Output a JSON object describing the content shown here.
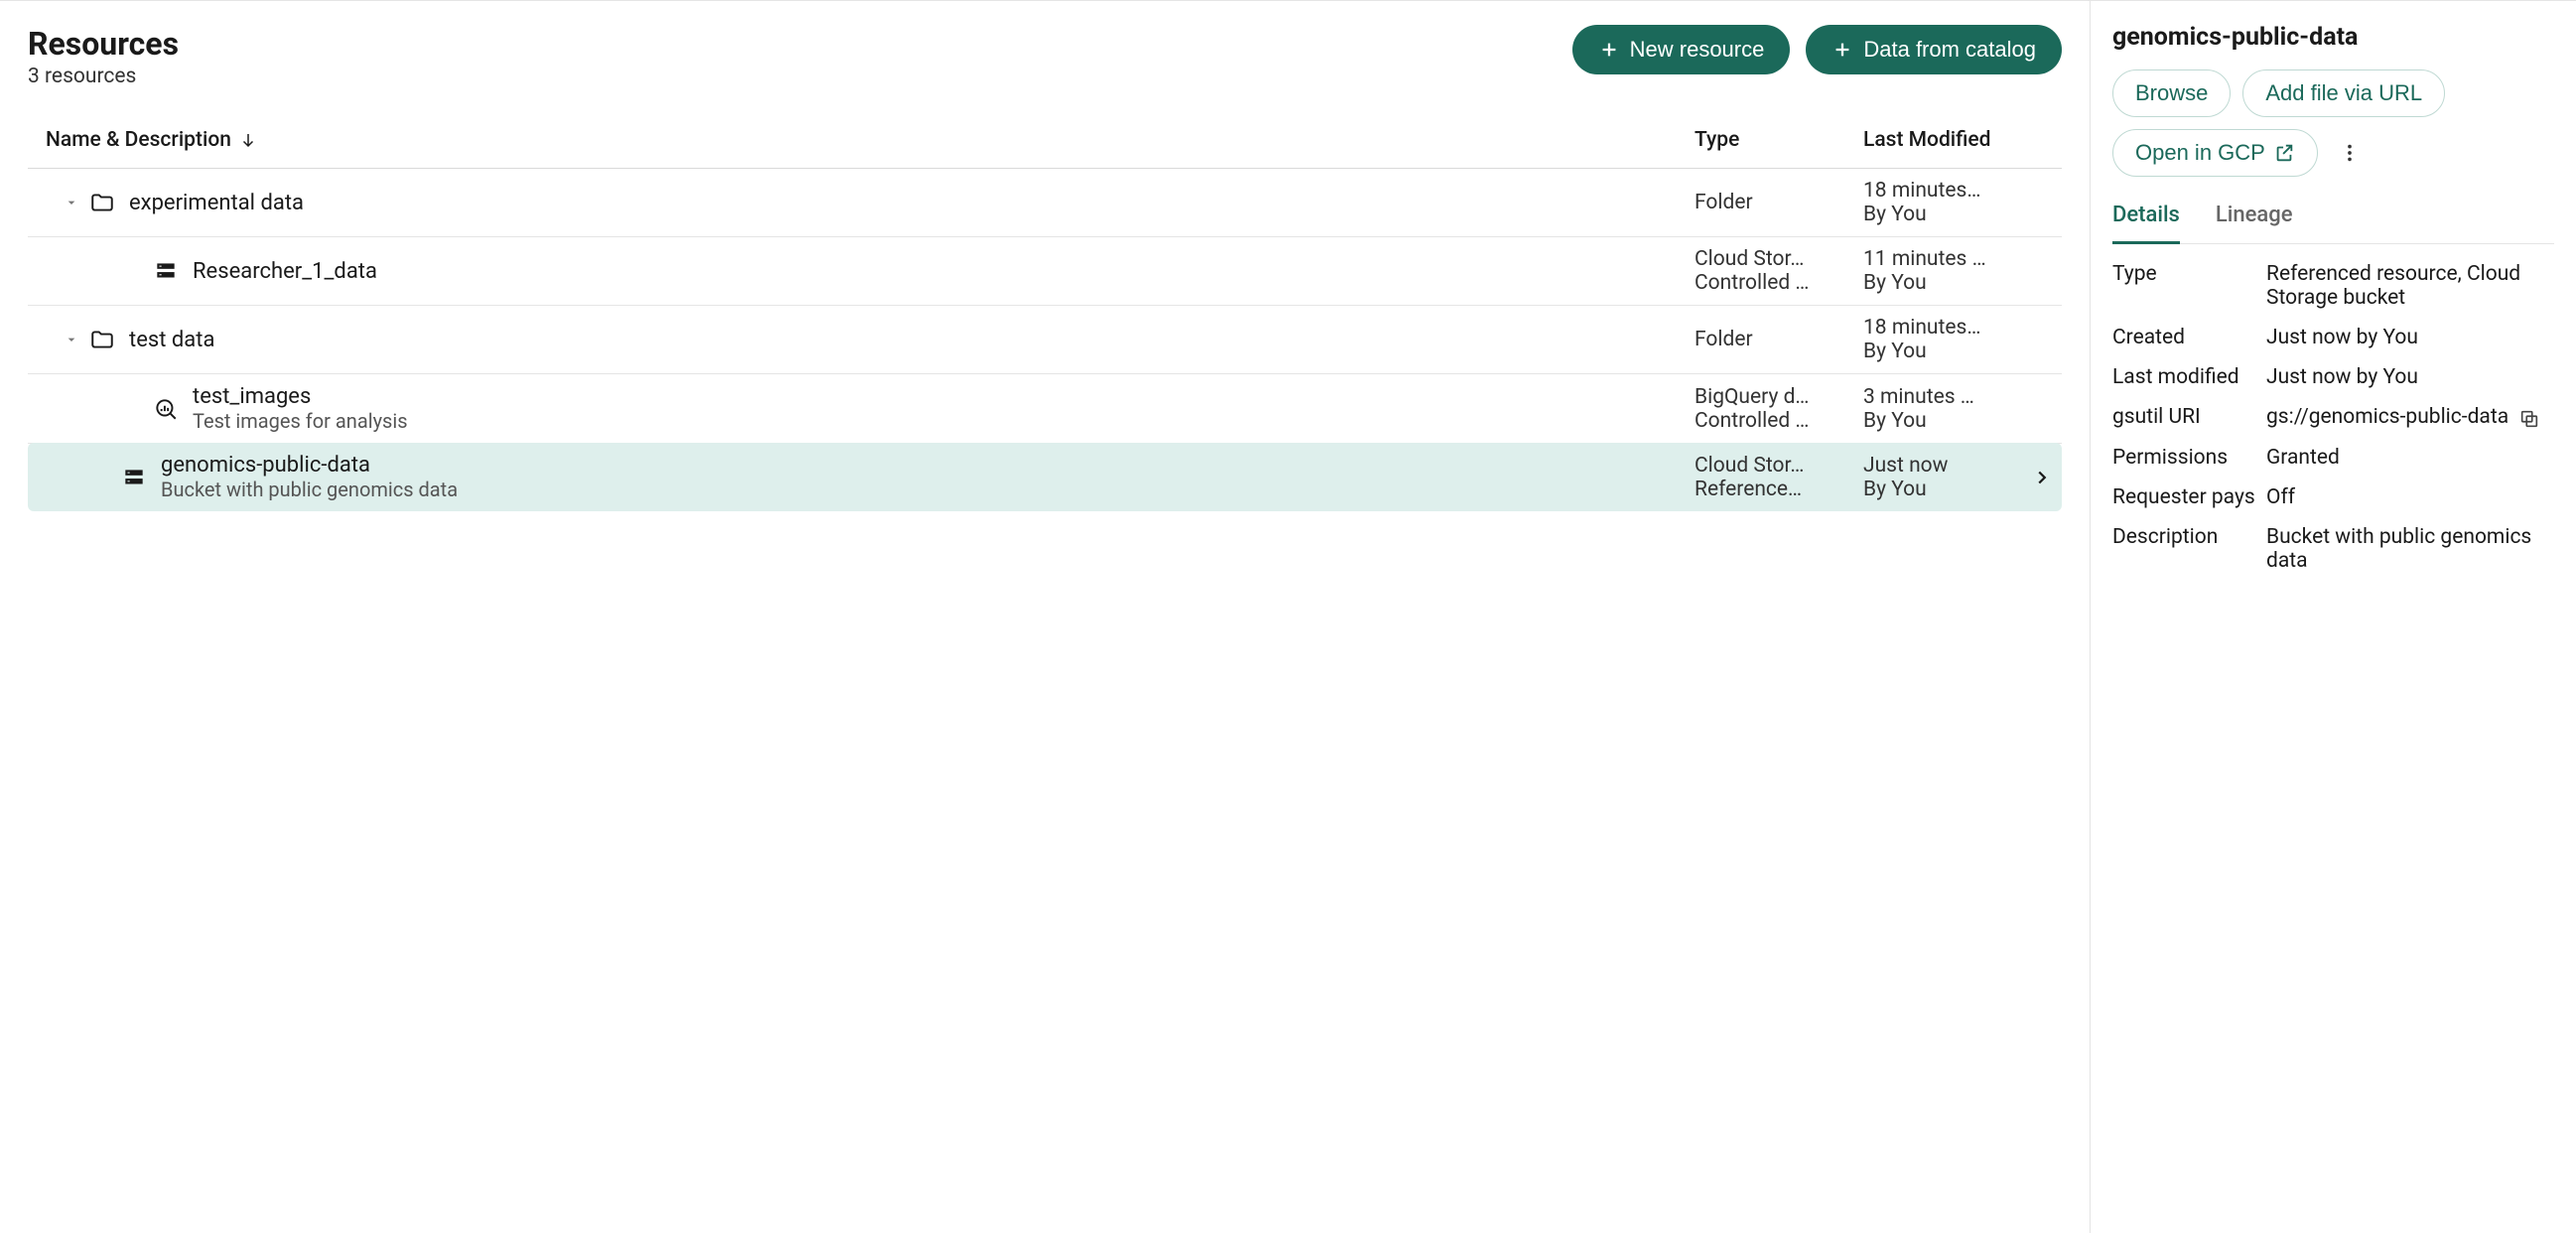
{
  "header": {
    "title": "Resources",
    "subtitle": "3 resources",
    "new_resource_label": "New resource",
    "data_catalog_label": "Data from catalog"
  },
  "columns": {
    "name": "Name & Description",
    "type": "Type",
    "modified": "Last Modified"
  },
  "rows": [
    {
      "name": "experimental data",
      "desc": "",
      "type1": "Folder",
      "type2": "",
      "mod1": "18 minutes…",
      "mod2": "By You",
      "icon": "folder",
      "level": 0,
      "expandable": true,
      "selected": false
    },
    {
      "name": "Researcher_1_data",
      "desc": "",
      "type1": "Cloud Stor…",
      "type2": "Controlled …",
      "mod1": "11 minutes …",
      "mod2": "By You",
      "icon": "storage",
      "level": 1,
      "expandable": false,
      "selected": false
    },
    {
      "name": "test data",
      "desc": "",
      "type1": "Folder",
      "type2": "",
      "mod1": "18 minutes…",
      "mod2": "By You",
      "icon": "folder",
      "level": 0,
      "expandable": true,
      "selected": false
    },
    {
      "name": "test_images",
      "desc": "Test images for analysis",
      "type1": "BigQuery d…",
      "type2": "Controlled …",
      "mod1": "3 minutes …",
      "mod2": "By You",
      "icon": "bq",
      "level": 1,
      "expandable": false,
      "selected": false
    },
    {
      "name": "genomics-public-data",
      "desc": "Bucket with public genomics data",
      "type1": "Cloud Stor…",
      "type2": "Reference…",
      "mod1": "Just now",
      "mod2": "By You",
      "icon": "storage",
      "level": 1,
      "expandable": false,
      "selected": true
    }
  ],
  "side": {
    "title": "genomics-public-data",
    "browse_label": "Browse",
    "add_url_label": "Add file via URL",
    "open_gcp_label": "Open in GCP",
    "tabs": {
      "details": "Details",
      "lineage": "Lineage"
    },
    "details": {
      "type_label": "Type",
      "type_value": "Referenced resource, Cloud Storage bucket",
      "created_label": "Created",
      "created_value": "Just now by You",
      "modified_label": "Last modified",
      "modified_value": "Just now by You",
      "gsutil_label": "gsutil URI",
      "gsutil_value": "gs://genomics-public-data",
      "permissions_label": "Permissions",
      "permissions_value": "Granted",
      "requester_label": "Requester pays",
      "requester_value": "Off",
      "description_label": "Description",
      "description_value": "Bucket with public genomics data"
    }
  }
}
